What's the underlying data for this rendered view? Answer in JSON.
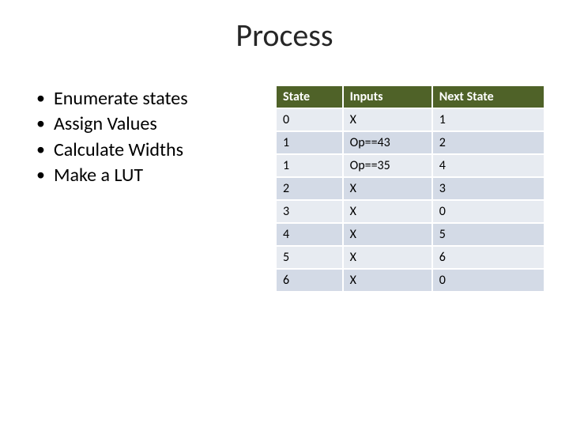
{
  "title": "Process",
  "bullets": [
    "Enumerate states",
    "Assign Values",
    "Calculate Widths",
    "Make a LUT"
  ],
  "table": {
    "headers": [
      "State",
      "Inputs",
      "Next State"
    ],
    "rows": [
      [
        "0",
        "X",
        "1"
      ],
      [
        "1",
        "Op==43",
        "2"
      ],
      [
        "1",
        "Op==35",
        "4"
      ],
      [
        "2",
        "X",
        "3"
      ],
      [
        "3",
        "X",
        "0"
      ],
      [
        "4",
        "X",
        "5"
      ],
      [
        "5",
        "X",
        "6"
      ],
      [
        "6",
        "X",
        "0"
      ]
    ]
  },
  "chart_data": {
    "type": "table",
    "title": "Process",
    "columns": [
      "State",
      "Inputs",
      "Next State"
    ],
    "rows": [
      {
        "State": "0",
        "Inputs": "X",
        "Next State": "1"
      },
      {
        "State": "1",
        "Inputs": "Op==43",
        "Next State": "2"
      },
      {
        "State": "1",
        "Inputs": "Op==35",
        "Next State": "4"
      },
      {
        "State": "2",
        "Inputs": "X",
        "Next State": "3"
      },
      {
        "State": "3",
        "Inputs": "X",
        "Next State": "0"
      },
      {
        "State": "4",
        "Inputs": "X",
        "Next State": "5"
      },
      {
        "State": "5",
        "Inputs": "X",
        "Next State": "6"
      },
      {
        "State": "6",
        "Inputs": "X",
        "Next State": "0"
      }
    ]
  }
}
